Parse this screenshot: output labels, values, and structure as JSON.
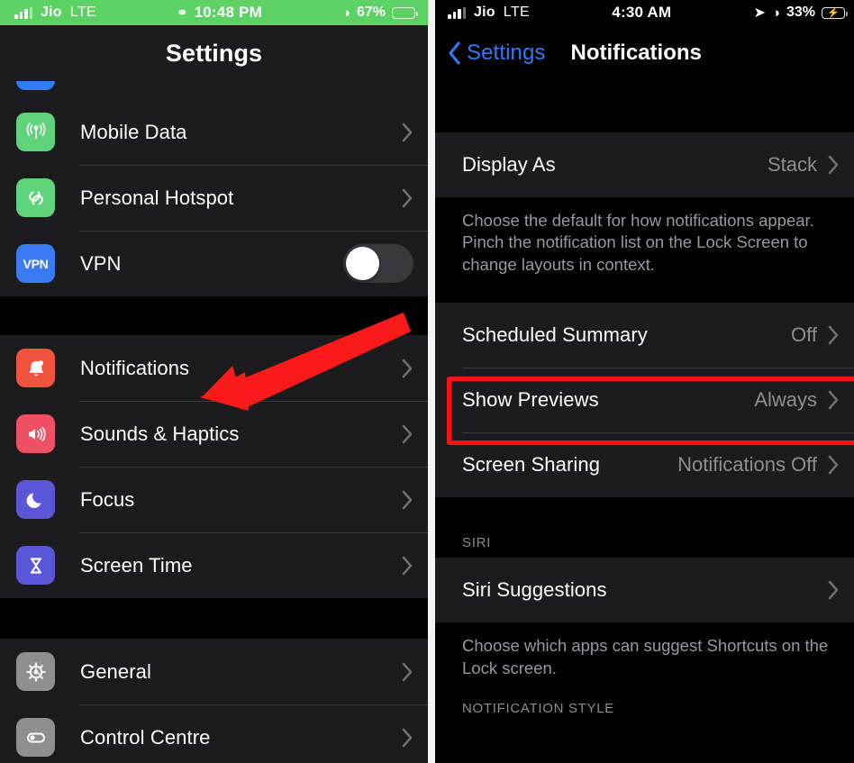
{
  "left_phone": {
    "status_bar": {
      "carrier": "Jio",
      "network": "LTE",
      "time": "10:48 PM",
      "battery_percent": "67%",
      "signal_icon": "signal-bars-icon",
      "link_icon": "carplay-link-icon",
      "orientation_lock_icon": "rotation-lock-icon",
      "battery_icon": "battery-icon",
      "bar_color": "#5cd265"
    },
    "nav": {
      "title": "Settings"
    },
    "rows": [
      {
        "label": "Mobile Data",
        "icon": "mobile-data-icon",
        "icon_color": "#5ed37a",
        "accessory": "chevron",
        "value": ""
      },
      {
        "label": "Personal Hotspot",
        "icon": "personal-hotspot-icon",
        "icon_color": "#5ed37a",
        "accessory": "chevron",
        "value": ""
      },
      {
        "label": "VPN",
        "icon": "vpn-icon",
        "icon_color": "#3a7bf5",
        "accessory": "toggle",
        "toggle_on": false,
        "icon_text": "VPN"
      }
    ],
    "rows_group2": [
      {
        "label": "Notifications",
        "icon": "notifications-bell-icon",
        "icon_color": "#f0543c",
        "accessory": "chevron"
      },
      {
        "label": "Sounds & Haptics",
        "icon": "sounds-haptics-speaker-icon",
        "icon_color": "#f05065",
        "accessory": "chevron"
      },
      {
        "label": "Focus",
        "icon": "focus-moon-icon",
        "icon_color": "#5b57d8",
        "accessory": "chevron"
      },
      {
        "label": "Screen Time",
        "icon": "screen-time-hourglass-icon",
        "icon_color": "#5b57d8",
        "accessory": "chevron"
      }
    ],
    "rows_group3": [
      {
        "label": "General",
        "icon": "general-gear-icon",
        "icon_color": "#8e8e93",
        "accessory": "chevron"
      },
      {
        "label": "Control Centre",
        "icon": "control-centre-toggle-icon",
        "icon_color": "#8e8e93",
        "accessory": "chevron"
      }
    ],
    "annotation": {
      "arrow": "red-arrow-pointing-to-notifications",
      "color": "#fb1a1a"
    }
  },
  "right_phone": {
    "status_bar": {
      "carrier": "Jio",
      "network": "LTE",
      "time": "4:30 AM",
      "battery_percent": "33%",
      "location_icon": "location-arrow-icon",
      "orientation_lock_icon": "rotation-lock-icon",
      "battery_icon": "battery-charging-icon",
      "battery_color": "#3ad058"
    },
    "nav": {
      "back_label": "Settings",
      "title": "Notifications",
      "back_icon": "chevron-left-icon",
      "accent": "#2f7cf6"
    },
    "rows": [
      {
        "label": "Display As",
        "value": "Stack",
        "accessory": "chevron"
      }
    ],
    "footnote_1": "Choose the default for how notifications appear. Pinch the notification list on the Lock Screen to change layouts in context.",
    "rows_group2": [
      {
        "label": "Scheduled Summary",
        "value": "Off",
        "accessory": "chevron"
      },
      {
        "label": "Show Previews",
        "value": "Always",
        "accessory": "chevron",
        "highlighted": true
      },
      {
        "label": "Screen Sharing",
        "value": "Notifications Off",
        "accessory": "chevron"
      }
    ],
    "section_siri": "SIRI",
    "rows_group3": [
      {
        "label": "Siri Suggestions",
        "value": "",
        "accessory": "chevron"
      }
    ],
    "footnote_2": "Choose which apps can suggest Shortcuts on the Lock screen.",
    "section_notification_style": "NOTIFICATION STYLE",
    "annotation": {
      "highlight": "red-rectangle-around-show-previews",
      "color": "#ff1111"
    }
  }
}
